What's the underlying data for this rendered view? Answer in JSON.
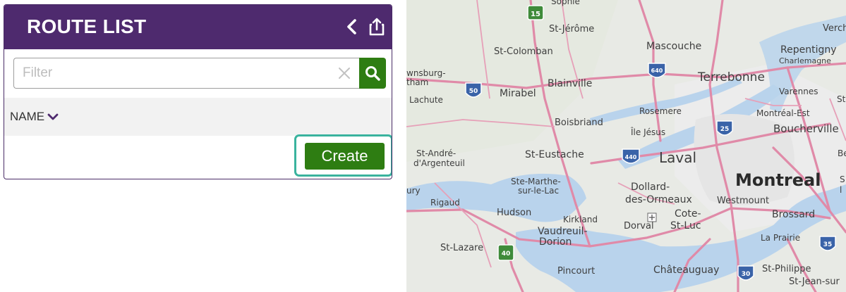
{
  "route_panel": {
    "title": "ROUTE LIST",
    "filter": {
      "placeholder": "Filter",
      "value": ""
    },
    "column_header": "NAME",
    "create_label": "Create"
  },
  "map": {
    "labels": {
      "sophie": "Sophie",
      "st_jerome": "St-Jérôme",
      "verch": "Verche",
      "st_colomban": "St-Colomban",
      "mascouche": "Mascouche",
      "repentigny": "Repentigny",
      "charlemagne": "Charlemagne",
      "brownsburg": "wnsburg-",
      "tham": "tham",
      "lachute": "Lachute",
      "mirabel": "Mirabel",
      "blainville": "Blainville",
      "terrebonne": "Terrebonne",
      "varennes": "Varennes",
      "st_edge": "St",
      "rosemere": "Rosemere",
      "montreal_est": "Montréal-Est",
      "boisbriand": "Boisbriand",
      "ile_jesus": "Île Jésus",
      "boucherville": "Boucherville",
      "st_andre": "St-André-",
      "d_argenteuil": "d'Argenteuil",
      "st_eustache": "St-Eustache",
      "laval": "Laval",
      "be_edge": "Be",
      "montreal": "Montreal",
      "ury": "ury",
      "ste_marthe": "Ste-Marthe-",
      "sur_le_lac": "sur-le-Lac",
      "dollard": "Dollard-",
      "des_ormeaux": "des-Ormeaux",
      "westmount": "Westmount",
      "s_edge": "S",
      "l_edge": "l",
      "rigaud": "Rigaud",
      "hudson": "Hudson",
      "kirkland": "Kirkland",
      "cote": "Cote-",
      "st_luc": "St-Luc",
      "brossard": "Brossard",
      "dorval": "Dorval",
      "vaudreuil": "Vaudreuil-",
      "dorion": "Dorion",
      "la_prairie": "La Prairie",
      "st_lazare": "St-Lazare",
      "pincourt": "Pincourt",
      "chateauguay": "Châteauguay",
      "st_philippe": "St-Philippe",
      "st_jean": "St-Jean-sur"
    },
    "shields": {
      "r15": "15",
      "r640": "640",
      "r50": "50",
      "r25": "25",
      "r440": "440",
      "r40": "40",
      "r30": "30",
      "r35": "35"
    }
  }
}
